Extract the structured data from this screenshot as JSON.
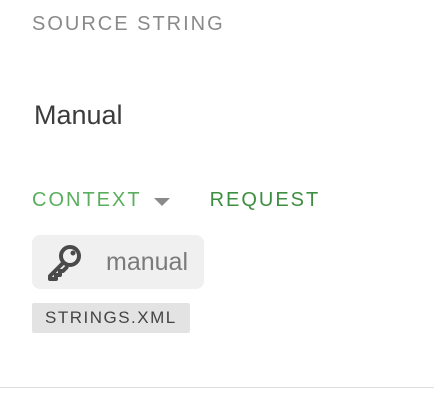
{
  "source_label": "SOURCE STRING",
  "source_text": "Manual",
  "tabs": {
    "context": "CONTEXT",
    "request": "REQUEST"
  },
  "key": {
    "icon": "key-icon",
    "value": "manual"
  },
  "file": "STRINGS.XML",
  "colors": {
    "accent_green": "#5aae5e",
    "request_green": "#3e8e41",
    "label_gray": "#8a8a8a",
    "chip_bg": "#f0f0f0",
    "badge_bg": "#e3e3e3"
  }
}
